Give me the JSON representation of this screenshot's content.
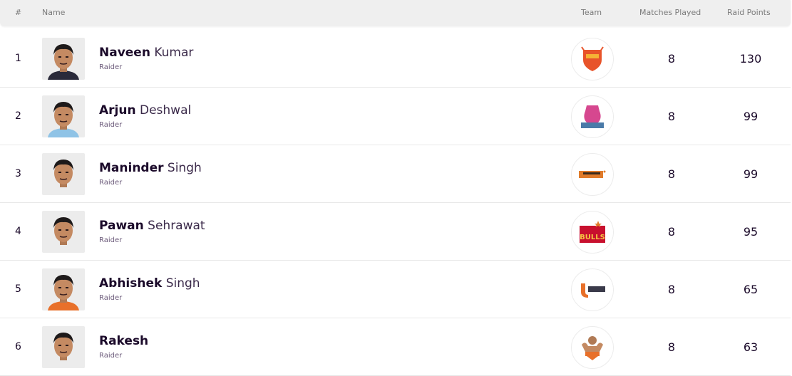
{
  "header": {
    "rank": "#",
    "name": "Name",
    "team": "Team",
    "matches": "Matches Played",
    "points": "Raid Points"
  },
  "rows": [
    {
      "rank": "1",
      "first": "Naveen",
      "last": "Kumar",
      "role": "Raider",
      "team_logo": "dabang-delhi-logo",
      "team_color": "#e8542a",
      "matches": "8",
      "points": "130",
      "jersey": "#2a2a3a"
    },
    {
      "rank": "2",
      "first": "Arjun",
      "last": "Deshwal",
      "role": "Raider",
      "team_logo": "jaipur-pink-panthers-logo",
      "team_color": "#d6478f",
      "matches": "8",
      "points": "99",
      "jersey": "#8fc3e6"
    },
    {
      "rank": "3",
      "first": "Maninder",
      "last": "Singh",
      "role": "Raider",
      "team_logo": "bengal-warriors-logo",
      "team_color": "#e07b2a",
      "matches": "8",
      "points": "99",
      "jersey": "#ececec"
    },
    {
      "rank": "4",
      "first": "Pawan",
      "last": "Sehrawat",
      "role": "Raider",
      "team_logo": "bengaluru-bulls-logo",
      "team_color": "#c8102e",
      "matches": "8",
      "points": "95",
      "jersey": "#ececec"
    },
    {
      "rank": "5",
      "first": "Abhishek",
      "last": "Singh",
      "role": "Raider",
      "team_logo": "u-mumba-logo",
      "team_color": "#e8702a",
      "matches": "8",
      "points": "65",
      "jersey": "#e8702a"
    },
    {
      "rank": "6",
      "first": "Rakesh",
      "last": "",
      "role": "Raider",
      "team_logo": "gujarat-giants-logo",
      "team_color": "#e8702a",
      "matches": "8",
      "points": "63",
      "jersey": "#ececec"
    }
  ]
}
